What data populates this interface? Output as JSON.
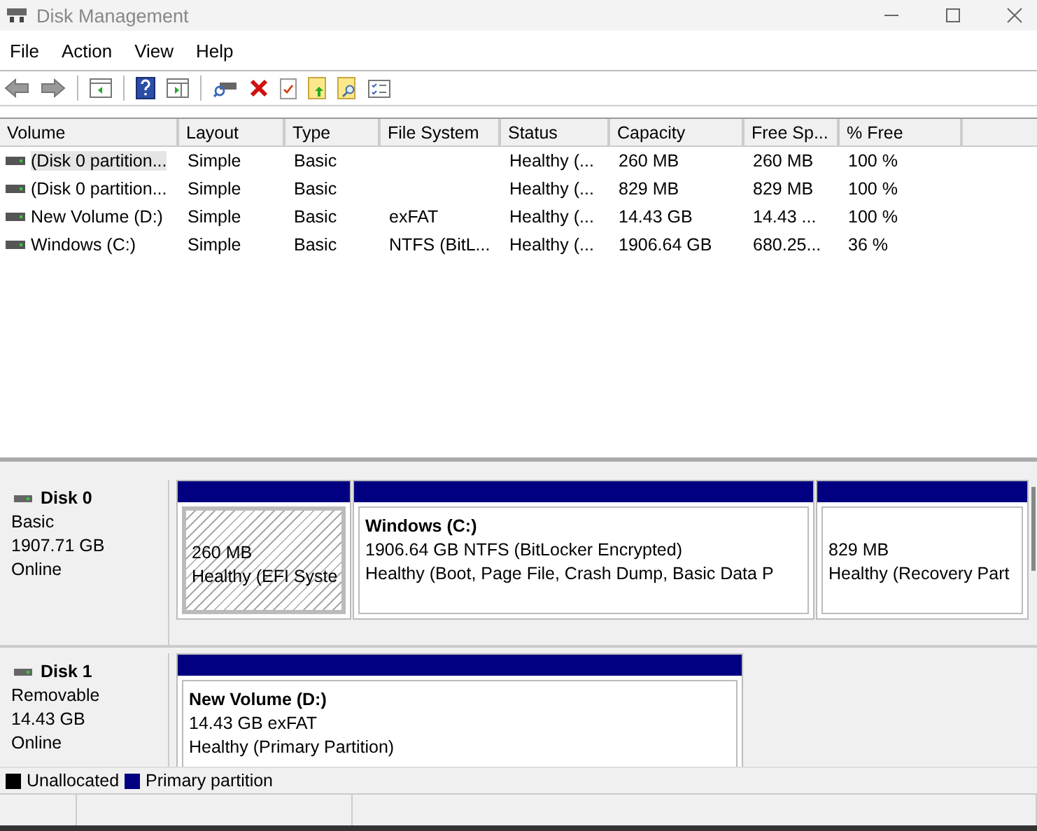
{
  "window": {
    "title": "Disk Management"
  },
  "menu": [
    "File",
    "Action",
    "View",
    "Help"
  ],
  "table": {
    "columns": [
      "Volume",
      "Layout",
      "Type",
      "File System",
      "Status",
      "Capacity",
      "Free Sp...",
      "% Free"
    ],
    "rows": [
      {
        "selected": true,
        "cells": [
          "(Disk 0 partition...",
          "Simple",
          "Basic",
          null,
          "Healthy (...",
          "260 MB",
          "260 MB",
          "100 %"
        ]
      },
      {
        "selected": false,
        "cells": [
          "(Disk 0 partition...",
          "Simple",
          "Basic",
          null,
          "Healthy (...",
          "829 MB",
          "829 MB",
          "100 %"
        ]
      },
      {
        "selected": false,
        "cells": [
          "New Volume (D:)",
          "Simple",
          "Basic",
          "exFAT",
          "Healthy (...",
          "14.43 GB",
          "14.43 ...",
          "100 %"
        ]
      },
      {
        "selected": false,
        "cells": [
          "Windows (C:)",
          "Simple",
          "Basic",
          "NTFS (BitL...",
          "Healthy (...",
          "1906.64 GB",
          "680.25...",
          "36 %"
        ]
      }
    ]
  },
  "disks": [
    {
      "name": "Disk 0",
      "lines": [
        "Basic",
        "1907.71 GB",
        "Online"
      ],
      "partitions": [
        {
          "selected": true,
          "size": "260 MB",
          "status": "Healthy (EFI Syste"
        },
        {
          "selected": false,
          "name": "Windows  (C:)",
          "size": "1906.64 GB NTFS (BitLocker Encrypted)",
          "status": "Healthy (Boot, Page File, Crash Dump, Basic Data P"
        },
        {
          "selected": false,
          "size": "829 MB",
          "status": "Healthy (Recovery Part"
        }
      ]
    },
    {
      "name": "Disk 1",
      "lines": [
        "Removable",
        "14.43 GB",
        "Online"
      ],
      "partitions": [
        {
          "selected": false,
          "name": "New Volume  (D:)",
          "size": "14.43 GB exFAT",
          "status": "Healthy (Primary Partition)"
        }
      ]
    }
  ],
  "legend": [
    {
      "label": "Unallocated",
      "color": "#000000"
    },
    {
      "label": "Primary partition",
      "color": "#000080"
    }
  ]
}
